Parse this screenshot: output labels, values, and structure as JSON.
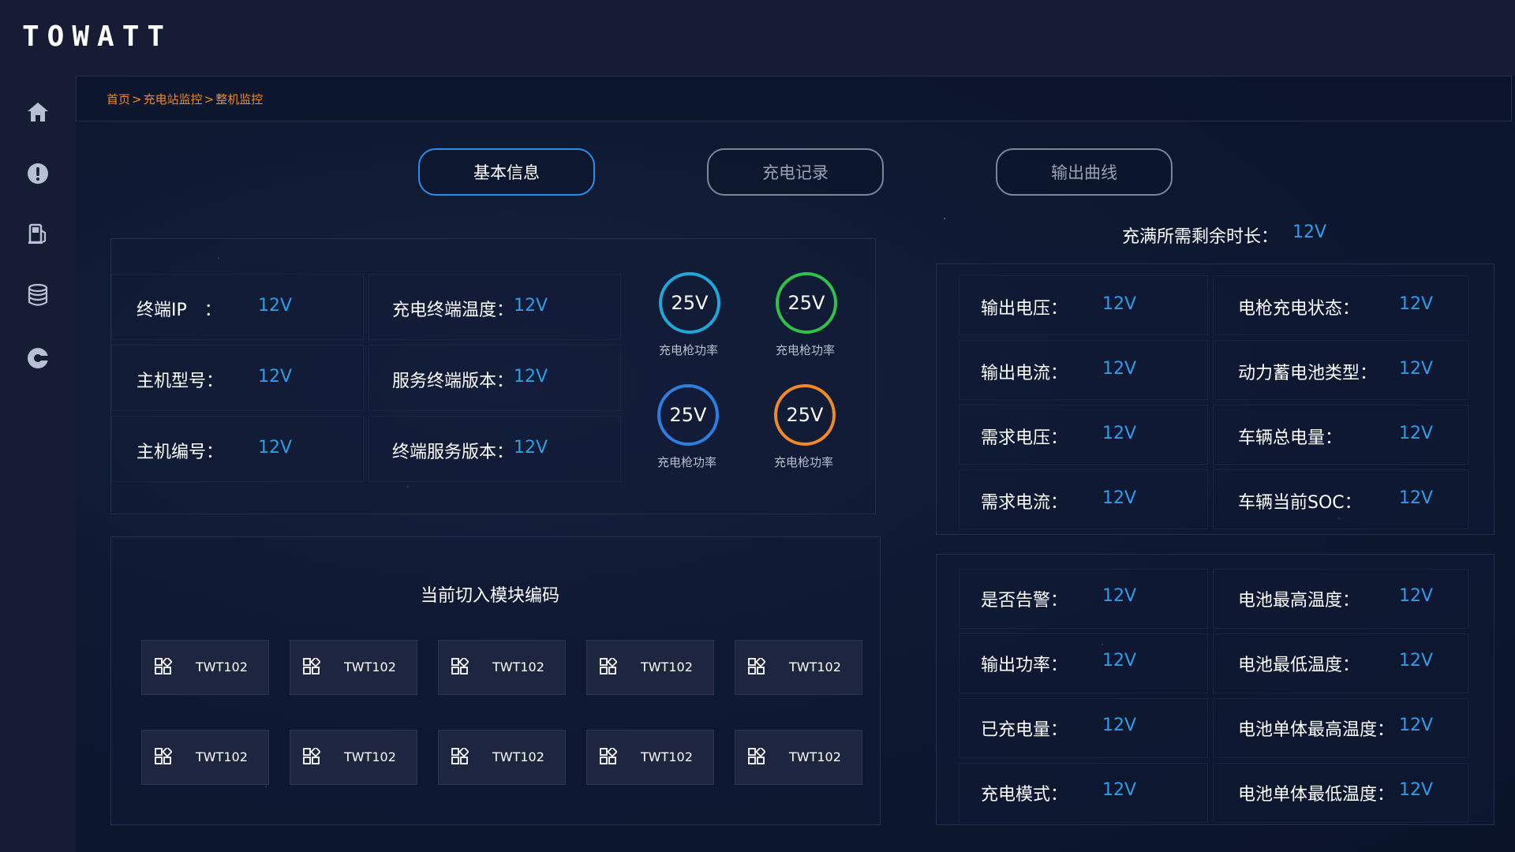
{
  "app": {
    "logo": "TOWATT"
  },
  "sidebar": {
    "items": [
      {
        "icon": "home-icon"
      },
      {
        "icon": "alert-icon"
      },
      {
        "icon": "fuel-pump-icon"
      },
      {
        "icon": "database-icon"
      },
      {
        "icon": "settings-icon"
      }
    ]
  },
  "breadcrumb": {
    "home": "首页",
    "sep": ">",
    "station": "充电站监控",
    "current": "整机监控"
  },
  "tabs": [
    {
      "label": "基本信息",
      "active": true
    },
    {
      "label": "充电记录",
      "active": false
    },
    {
      "label": "输出曲线",
      "active": false
    }
  ],
  "basic_info": {
    "terminal_ip": {
      "label": "终端IP　：",
      "value": "12V"
    },
    "host_model": {
      "label": "主机型号：",
      "value": "12V"
    },
    "host_number": {
      "label": "主机编号：",
      "value": "12V"
    },
    "terminal_temp": {
      "label": "充电终端温度：",
      "value": "12V"
    },
    "service_version": {
      "label": "服务终端版本：",
      "value": "12V"
    },
    "terminal_service_version": {
      "label": "终端服务版本：",
      "value": "12V"
    }
  },
  "gauges": [
    {
      "value": "25V",
      "label": "充电枪功率",
      "color": "#1ea8d8"
    },
    {
      "value": "25V",
      "label": "充电枪功率",
      "color": "#2fc24a"
    },
    {
      "value": "25V",
      "label": "充电枪功率",
      "color": "#2a7fe0"
    },
    {
      "value": "25V",
      "label": "充电枪功率",
      "color": "#f08a24"
    }
  ],
  "modules": {
    "title": "当前切入模块编码",
    "items": [
      "TWT102",
      "TWT102",
      "TWT102",
      "TWT102",
      "TWT102",
      "TWT102",
      "TWT102",
      "TWT102",
      "TWT102",
      "TWT102"
    ]
  },
  "remaining": {
    "label": "充满所需剩余时长：",
    "value": "12V"
  },
  "charge_status": {
    "output_voltage": {
      "label": "输出电压：",
      "value": "12V"
    },
    "output_current": {
      "label": "输出电流：",
      "value": "12V"
    },
    "demand_voltage": {
      "label": "需求电压：",
      "value": "12V"
    },
    "demand_current": {
      "label": "需求电流：",
      "value": "12V"
    },
    "gun_status": {
      "label": "电枪充电状态：",
      "value": "12V"
    },
    "battery_type": {
      "label": "动力蓄电池类型：",
      "value": "12V"
    },
    "vehicle_capacity": {
      "label": "车辆总电量：",
      "value": "12V"
    },
    "vehicle_soc": {
      "label": "车辆当前SOC：",
      "value": "12V"
    }
  },
  "battery_status": {
    "alarm": {
      "label": "是否告警：",
      "value": "12V"
    },
    "output_power": {
      "label": "输出功率：",
      "value": "12V"
    },
    "charged": {
      "label": "已充电量：",
      "value": "12V"
    },
    "charge_mode": {
      "label": "充电模式：",
      "value": "12V"
    },
    "max_temp": {
      "label": "电池最高温度：",
      "value": "12V"
    },
    "min_temp": {
      "label": "电池最低温度：",
      "value": "12V"
    },
    "cell_max_temp": {
      "label": "电池单体最高温度：",
      "value": "12V"
    },
    "cell_min_temp": {
      "label": "电池单体最低温度：",
      "value": "12V"
    }
  },
  "colors": {
    "accent": "#2c9de8",
    "breadcrumb": "#f08a24",
    "background": "#0b1226"
  }
}
